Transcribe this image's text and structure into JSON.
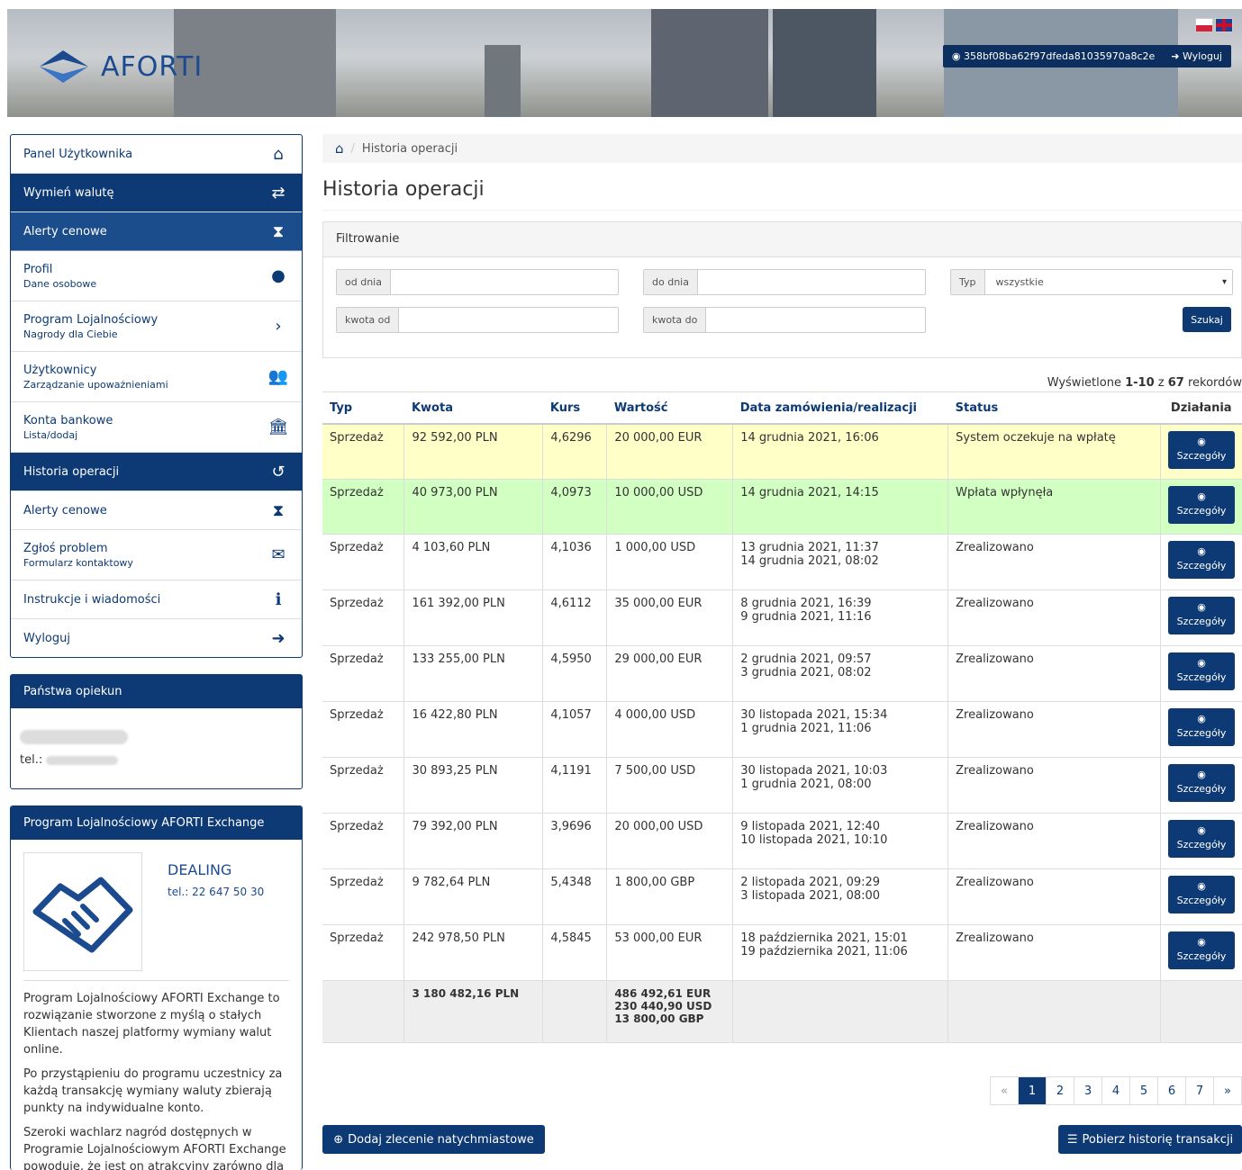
{
  "header": {
    "logo_text": "AFORTI",
    "user_id": "358bf08ba62f97dfeda81035970a8c2e",
    "logout_label": "Wyloguj"
  },
  "sidebar": {
    "items": [
      {
        "label": "Panel Użytkownika",
        "sub": "",
        "icon": "home-icon",
        "glyph": "⌂"
      },
      {
        "label": "Wymień walutę",
        "sub": "",
        "icon": "exchange-icon",
        "glyph": "⇄"
      },
      {
        "label": "Alerty cenowe",
        "sub": "",
        "icon": "hourglass-icon",
        "glyph": "⧗"
      },
      {
        "label": "Profil",
        "sub": "Dane osobowe",
        "icon": "user-icon",
        "glyph": "●"
      },
      {
        "label": "Program Lojalnościowy",
        "sub": "Nagrody dla Ciebie",
        "icon": "chevron-right-icon",
        "glyph": "›"
      },
      {
        "label": "Użytkownicy",
        "sub": "Zarządzanie upoważnieniami",
        "icon": "users-icon",
        "glyph": "👥"
      },
      {
        "label": "Konta bankowe",
        "sub": "Lista/dodaj",
        "icon": "bank-icon",
        "glyph": "🏛"
      },
      {
        "label": "Historia operacji",
        "sub": "",
        "icon": "history-icon",
        "glyph": "↺"
      },
      {
        "label": "Alerty cenowe",
        "sub": "",
        "icon": "hourglass-icon",
        "glyph": "⧗"
      },
      {
        "label": "Zgłoś problem",
        "sub": "Formularz kontaktowy",
        "icon": "envelope-icon",
        "glyph": "✉"
      },
      {
        "label": "Instrukcje i wiadomości",
        "sub": "",
        "icon": "info-icon",
        "glyph": "ℹ"
      },
      {
        "label": "Wyloguj",
        "sub": "",
        "icon": "logout-icon",
        "glyph": "➜"
      }
    ]
  },
  "opiekun": {
    "title": "Państwa opiekun",
    "tel_label": "tel.:"
  },
  "loyalty": {
    "title": "Program Lojalnościowy AFORTI Exchange",
    "dealing": "DEALING",
    "tel": "tel.: 22 647 50 30",
    "p1": "Program Lojalnościowy AFORTI Exchange to rozwiązanie stworzone z myślą o stałych Klientach naszej platformy wymiany walut online.",
    "p2": "Po przystąpieniu do programu uczestnicy za każdą transakcję wymiany waluty zbierają punkty na indywidualne konto.",
    "p3": "Szeroki wachlarz nagród dostępnych w Programie Lojalnościowym AFORTI Exchange powoduje, że jest on atrakcyjny zarówno dla"
  },
  "breadcrumb": {
    "current": "Historia operacji"
  },
  "page_title": "Historia operacji",
  "filter": {
    "title": "Filtrowanie",
    "od_dnia": "od dnia",
    "do_dnia": "do dnia",
    "typ": "Typ",
    "typ_value": "wszystkie",
    "kwota_od": "kwota od",
    "kwota_do": "kwota do",
    "search": "Szukaj"
  },
  "records": {
    "prefix": "Wyświetlone ",
    "range": "1-10",
    "mid": " z ",
    "total": "67",
    "suffix": " rekordów"
  },
  "table": {
    "headers": [
      "Typ",
      "Kwota",
      "Kurs",
      "Wartość",
      "Data zamówienia/realizacji",
      "Status",
      "Działania"
    ],
    "details_label": "Szczegóły",
    "rows": [
      {
        "typ": "Sprzedaż",
        "kwota": "92 592,00 PLN",
        "kurs": "4,6296",
        "wartosc": "20 000,00 EUR",
        "d1": "14 grudnia 2021, 16:06",
        "d2": "",
        "status": "System oczekuje na wpłatę",
        "color": "yellow"
      },
      {
        "typ": "Sprzedaż",
        "kwota": "40 973,00 PLN",
        "kurs": "4,0973",
        "wartosc": "10 000,00 USD",
        "d1": "14 grudnia 2021, 14:15",
        "d2": "",
        "status": "Wpłata wpłynęła",
        "color": "green"
      },
      {
        "typ": "Sprzedaż",
        "kwota": "4 103,60 PLN",
        "kurs": "4,1036",
        "wartosc": "1 000,00 USD",
        "d1": "13 grudnia 2021, 11:37",
        "d2": "14 grudnia 2021, 08:02",
        "status": "Zrealizowano",
        "color": ""
      },
      {
        "typ": "Sprzedaż",
        "kwota": "161 392,00 PLN",
        "kurs": "4,6112",
        "wartosc": "35 000,00 EUR",
        "d1": "8 grudnia 2021, 16:39",
        "d2": "9 grudnia 2021, 11:16",
        "status": "Zrealizowano",
        "color": ""
      },
      {
        "typ": "Sprzedaż",
        "kwota": "133 255,00 PLN",
        "kurs": "4,5950",
        "wartosc": "29 000,00 EUR",
        "d1": "2 grudnia 2021, 09:57",
        "d2": "3 grudnia 2021, 08:02",
        "status": "Zrealizowano",
        "color": ""
      },
      {
        "typ": "Sprzedaż",
        "kwota": "16 422,80 PLN",
        "kurs": "4,1057",
        "wartosc": "4 000,00 USD",
        "d1": "30 listopada 2021, 15:34",
        "d2": "1 grudnia 2021, 11:06",
        "status": "Zrealizowano",
        "color": ""
      },
      {
        "typ": "Sprzedaż",
        "kwota": "30 893,25 PLN",
        "kurs": "4,1191",
        "wartosc": "7 500,00 USD",
        "d1": "30 listopada 2021, 10:03",
        "d2": "1 grudnia 2021, 08:00",
        "status": "Zrealizowano",
        "color": ""
      },
      {
        "typ": "Sprzedaż",
        "kwota": "79 392,00 PLN",
        "kurs": "3,9696",
        "wartosc": "20 000,00 USD",
        "d1": "9 listopada 2021, 12:40",
        "d2": "10 listopada 2021, 10:10",
        "status": "Zrealizowano",
        "color": ""
      },
      {
        "typ": "Sprzedaż",
        "kwota": "9 782,64 PLN",
        "kurs": "5,4348",
        "wartosc": "1 800,00 GBP",
        "d1": "2 listopada 2021, 09:29",
        "d2": "3 listopada 2021, 08:00",
        "status": "Zrealizowano",
        "color": ""
      },
      {
        "typ": "Sprzedaż",
        "kwota": "242 978,50 PLN",
        "kurs": "4,5845",
        "wartosc": "53 000,00 EUR",
        "d1": "18 października 2021, 15:01",
        "d2": "19 października 2021, 11:06",
        "status": "Zrealizowano",
        "color": ""
      }
    ],
    "sum": {
      "kwota": "3 180 482,16 PLN",
      "eur": "486 492,61 EUR",
      "usd": "230 440,90 USD",
      "gbp": "13 800,00 GBP"
    }
  },
  "pagination": {
    "prev": "«",
    "pages": [
      "1",
      "2",
      "3",
      "4",
      "5",
      "6",
      "7"
    ],
    "next": "»",
    "current": "1"
  },
  "actions": {
    "add": "Dodaj zlecenie natychmiastowe",
    "download": "Pobierz historię transakcji"
  }
}
